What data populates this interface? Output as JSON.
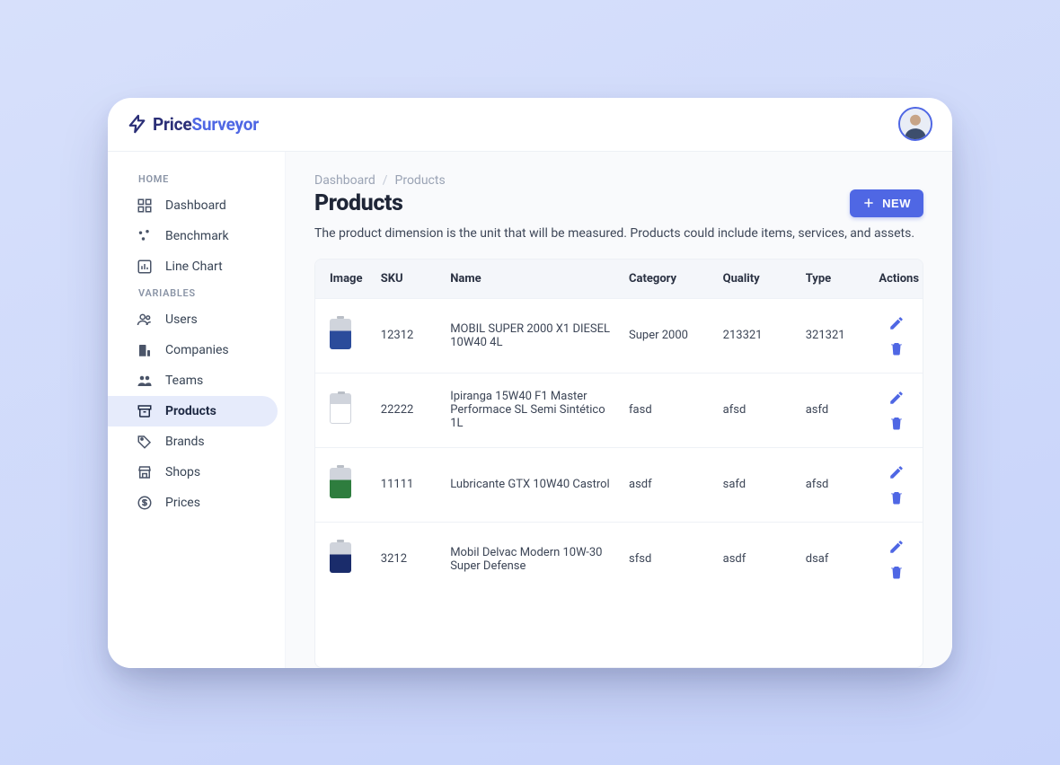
{
  "brand": {
    "name_a": "Price",
    "name_b": "Surveyor"
  },
  "sidebar": {
    "sections": [
      {
        "heading": "HOME",
        "items": [
          {
            "id": "dashboard",
            "label": "Dashboard",
            "icon": "grid"
          },
          {
            "id": "benchmark",
            "label": "Benchmark",
            "icon": "scatter"
          },
          {
            "id": "line-chart",
            "label": "Line Chart",
            "icon": "chart"
          }
        ]
      },
      {
        "heading": "VARIABLES",
        "items": [
          {
            "id": "users",
            "label": "Users",
            "icon": "users"
          },
          {
            "id": "companies",
            "label": "Companies",
            "icon": "building"
          },
          {
            "id": "teams",
            "label": "Teams",
            "icon": "team"
          },
          {
            "id": "products",
            "label": "Products",
            "icon": "archive",
            "active": true
          },
          {
            "id": "brands",
            "label": "Brands",
            "icon": "tag"
          },
          {
            "id": "shops",
            "label": "Shops",
            "icon": "store"
          },
          {
            "id": "prices",
            "label": "Prices",
            "icon": "dollar"
          }
        ]
      }
    ]
  },
  "breadcrumb": {
    "root": "Dashboard",
    "current": "Products"
  },
  "page": {
    "title": "Products",
    "new_button": "NEW",
    "description": "The product dimension is the unit that will be measured. Products could include items, services, and assets."
  },
  "table": {
    "headers": {
      "image": "Image",
      "sku": "SKU",
      "name": "Name",
      "category": "Category",
      "quality": "Quality",
      "type": "Type",
      "actions": "Actions"
    },
    "rows": [
      {
        "thumb": "blue",
        "sku": "12312",
        "name": "MOBIL SUPER 2000 X1 DIESEL 10W40 4L",
        "category": "Super 2000",
        "quality": "213321",
        "type": "321321"
      },
      {
        "thumb": "white",
        "sku": "22222",
        "name": "Ipiranga 15W40 F1 Master Performace SL Semi Sintético 1L",
        "category": "fasd",
        "quality": "afsd",
        "type": "asfd"
      },
      {
        "thumb": "green",
        "sku": "11111",
        "name": "Lubricante GTX 10W40 Castrol",
        "category": "asdf",
        "quality": "safd",
        "type": "afsd"
      },
      {
        "thumb": "navy",
        "sku": "3212",
        "name": "Mobil Delvac Modern 10W-30 Super Defense",
        "category": "sfsd",
        "quality": "asdf",
        "type": "dsaf"
      }
    ]
  }
}
